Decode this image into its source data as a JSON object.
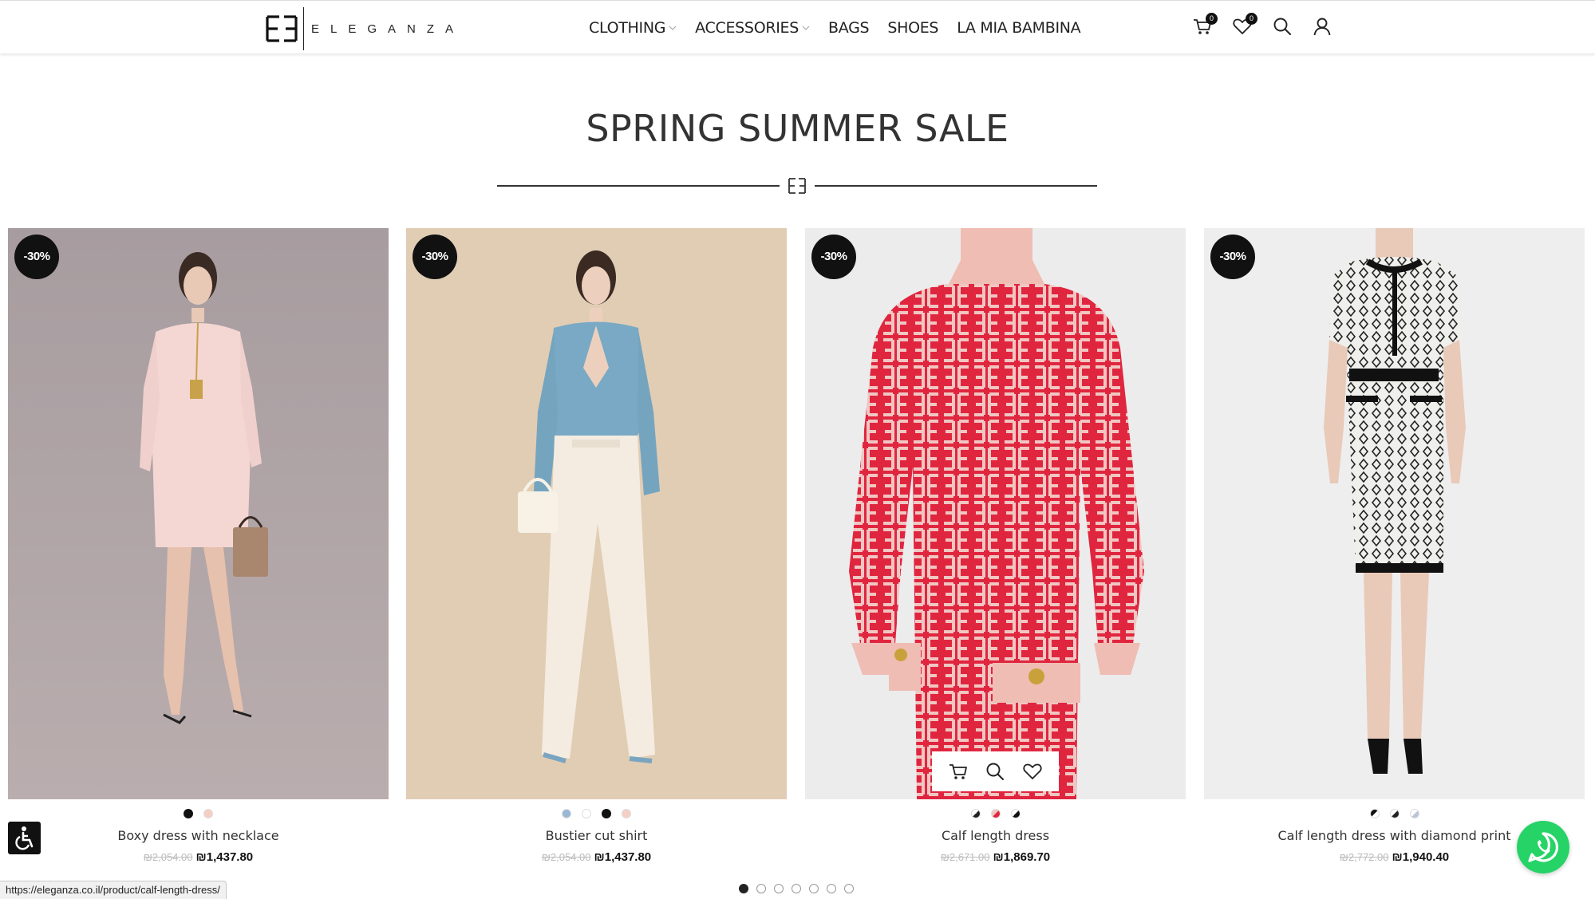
{
  "header": {
    "brand": "ELEGANZA",
    "nav": [
      {
        "label": "CLOTHING",
        "has_dropdown": true
      },
      {
        "label": "ACCESSORIES",
        "has_dropdown": true
      },
      {
        "label": "BAGS",
        "has_dropdown": false
      },
      {
        "label": "SHOES",
        "has_dropdown": false
      },
      {
        "label": "LA MIA BAMBINA",
        "has_dropdown": false
      }
    ],
    "cart_count": "0",
    "wishlist_count": "0",
    "icons": [
      "cart-icon",
      "heart-icon",
      "search-icon",
      "user-icon"
    ]
  },
  "section": {
    "title": "SPRING SUMMER SALE"
  },
  "products": [
    {
      "name": "Boxy dress with necklace",
      "discount": "-30%",
      "old_price": "₪2,054.00",
      "price": "₪1,437.80",
      "swatches": [
        "#111111",
        "#f5cfc4"
      ]
    },
    {
      "name": "Bustier cut shirt",
      "discount": "-30%",
      "old_price": "₪2,054.00",
      "price": "₪1,437.80",
      "swatches": [
        "#9ab8d6",
        "#ffffff",
        "#111111",
        "#f5cfc4"
      ]
    },
    {
      "name": "Calf length dress",
      "discount": "-30%",
      "old_price": "₪2,671.00",
      "price": "₪1,869.70",
      "swatches": [
        "#222222",
        "#e0263f",
        "#111111"
      ]
    },
    {
      "name": "Calf length dress with diamond print",
      "discount": "-30%",
      "old_price": "₪2,772.00",
      "price": "₪1,940.40",
      "swatches": [
        "#111111",
        "#222222",
        "#b9c6d8"
      ]
    }
  ],
  "pagination": {
    "pages": 7,
    "active": 1
  },
  "status_bar": {
    "url": "https://eleganza.co.il/product/calf-length-dress/"
  },
  "colors": {
    "accent": "#111111",
    "whatsapp": "#25d366",
    "red_pattern": "#e0263f"
  }
}
